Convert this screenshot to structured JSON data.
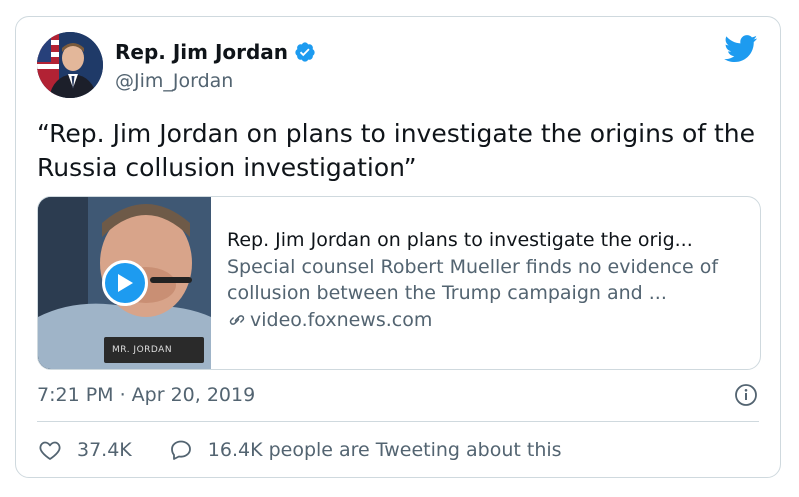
{
  "author": {
    "name": "Rep. Jim Jordan",
    "handle": "@Jim_Jordan",
    "verified_icon": "verified-badge-icon",
    "avatar": "avatar"
  },
  "tweet": {
    "text": "“Rep. Jim Jordan on plans to investigate the origins of the Russia collusion investigation”"
  },
  "link_card": {
    "title": "Rep. Jim Jordan on plans to investigate the orig...",
    "description": "Special counsel Robert Mueller finds no evidence of collusion between the Trump campaign and ...",
    "domain": "video.foxnews.com",
    "thumbnail_nameplate": "MR. JORDAN"
  },
  "meta": {
    "timestamp": "7:21 PM · Apr 20, 2019"
  },
  "actions": {
    "likes": "37.4K",
    "retweets_text": "16.4K people are Tweeting about this"
  },
  "colors": {
    "brand": "#1d9bf0",
    "text": "#0f1419",
    "secondary": "#536471",
    "border": "#cfd9de"
  }
}
